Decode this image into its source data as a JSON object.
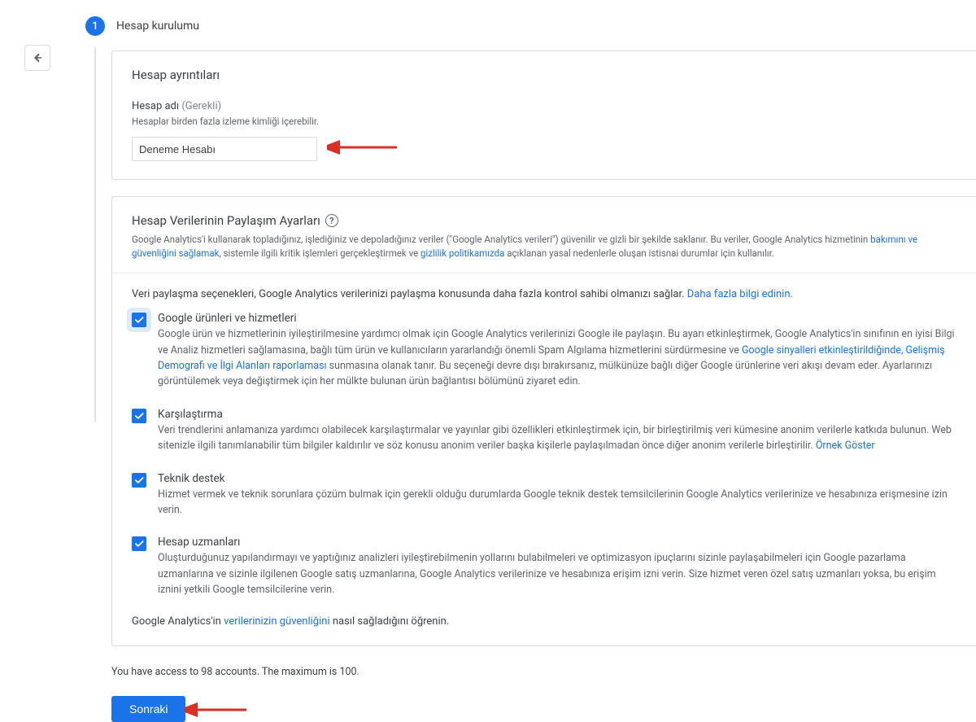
{
  "step": {
    "number": "1",
    "title": "Hesap kurulumu"
  },
  "card_details": {
    "title": "Hesap ayrıntıları",
    "name_label": "Hesap adı",
    "name_required": "(Gerekli)",
    "name_hint": "Hesaplar birden fazla izleme kimliği içerebilir.",
    "name_value": "Deneme Hesabı"
  },
  "sharing": {
    "title": "Hesap Verilerinin Paylaşım Ayarları",
    "intro_pre": "Google Analytics'i kullanarak topladığınız, işlediğiniz ve depoladığınız veriler (\"Google Analytics verileri\") güvenilir ve gizli bir şekilde saklanır. Bu veriler, Google Analytics hizmetinin ",
    "intro_link1": "bakımını ve güvenliğini sağlamak",
    "intro_mid": ", sistemle ilgili kritik işlemleri gerçekleştirmek ve ",
    "intro_link2": "gizlilik politikamızda",
    "intro_post": " açıklanan yasal nedenlerle oluşan istisnai durumlar için kullanılır.",
    "options_intro_pre": "Veri paylaşma seçenekleri, Google Analytics verilerinizi paylaşma konusunda daha fazla kontrol sahibi olmanızı sağlar. ",
    "options_intro_link": "Daha fazla bilgi edinin.",
    "opts": [
      {
        "title": "Google ürünleri ve hizmetleri",
        "desc_pre": "Google ürün ve hizmetlerinin iyileştirilmesine yardımcı olmak için Google Analytics verilerinizi Google ile paylaşın. Bu ayarı etkinleştirmek, Google Analytics'in sınıfının en iyisi Bilgi ve Analiz hizmetleri sağlamasına, bağlı tüm ürün ve kullanıcıların yararlandığı önemli Spam Algılama hizmetlerini sürdürmesine ve ",
        "desc_link": "Google sinyalleri etkinleştirildiğinde, Gelişmiş Demografi ve İlgi Alanları raporlaması",
        "desc_post": " sunmasına olanak tanır. Bu seçeneği devre dışı bırakırsanız, mülkünüze bağlı diğer Google ürünlerine veri akışı devam eder. Ayarlarınızı görüntülemek veya değiştirmek için her mülkte bulunan ürün bağlantısı bölümünü ziyaret edin."
      },
      {
        "title": "Karşılaştırma",
        "desc_pre": "Veri trendlerini anlamanıza yardımcı olabilecek karşılaştırmalar ve yayınlar gibi özellikleri etkinleştirmek için, bir birleştirilmiş veri kümesine anonim verilerle katkıda bulunun. Web sitenizle ilgili tanımlanabilir tüm bilgiler kaldırılır ve söz konusu anonim veriler başka kişilerle paylaşılmadan önce diğer anonim verilerle birleştirilir.   ",
        "desc_link": "Örnek Göster",
        "desc_post": ""
      },
      {
        "title": "Teknik destek",
        "desc_pre": "Hizmet vermek ve teknik sorunlara çözüm bulmak için gerekli olduğu durumlarda Google teknik destek temsilcilerinin Google Analytics verilerinize ve hesabınıza erişmesine izin verin.",
        "desc_link": "",
        "desc_post": ""
      },
      {
        "title": "Hesap uzmanları",
        "desc_pre": "Oluşturduğunuz yapılandırmayı ve yaptığınız analizleri iyileştirebilmenin yollarını bulabilmeleri ve optimizasyon ipuçlarını sizinle paylaşabilmeleri için Google pazarlama uzmanlarına ve sizinle ilgilenen Google satış uzmanlarına, Google Analytics verilerinize ve hesabınıza erişim izni verin. Size hizmet veren özel satış uzmanları yoksa, bu erişim iznini yetkili Google temsilcilerine verin.",
        "desc_link": "",
        "desc_post": ""
      }
    ],
    "footer_pre": "Google Analytics'in ",
    "footer_link": "verilerinizin güvenliğini",
    "footer_post": " nasıl sağladığını öğrenin."
  },
  "access_note": "You have access to 98 accounts. The maximum is 100.",
  "next_label": "Sonraki"
}
